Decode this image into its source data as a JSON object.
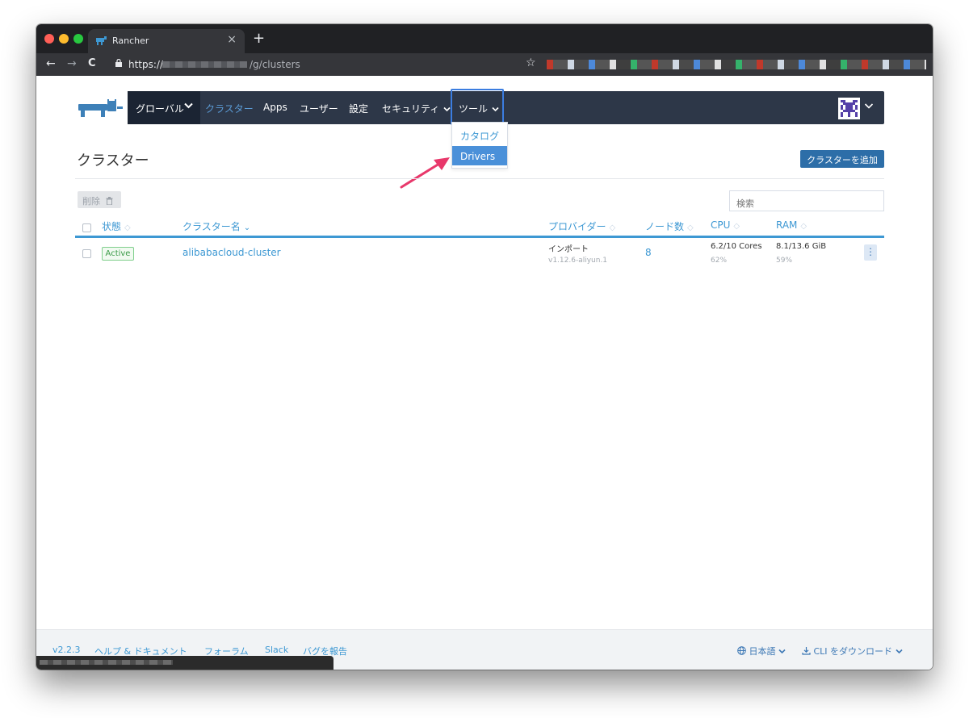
{
  "browser": {
    "tab_title": "Rancher",
    "tab_close": "×",
    "new_tab": "+",
    "back": "←",
    "forward": "→",
    "reload": "C",
    "url_scheme": "https://",
    "url_path": "/g/clusters",
    "star": "☆"
  },
  "nav": {
    "global_label": "グローバル",
    "items": [
      {
        "label": "クラスター",
        "active": true
      },
      {
        "label": "Apps"
      },
      {
        "label": "ユーザー"
      },
      {
        "label": "設定"
      },
      {
        "label": "セキュリティ"
      },
      {
        "label": "ツール"
      }
    ],
    "tools_menu": [
      "カタログ",
      "Drivers"
    ]
  },
  "page": {
    "title": "クラスター",
    "add_button": "クラスターを追加",
    "delete_button": "削除",
    "search_placeholder": "検索"
  },
  "table": {
    "headers": [
      "状態",
      "クラスター名",
      "プロバイダー",
      "ノード数",
      "CPU",
      "RAM"
    ],
    "sorted_column": "クラスター名",
    "rows": [
      {
        "state": "Active",
        "name": "alibabacloud-cluster",
        "provider": "インポート",
        "provider_version": "v1.12.6-aliyun.1",
        "nodes": "8",
        "cpu": "6.2/10 Cores",
        "cpu_pct": "62%",
        "ram": "8.1/13.6 GiB",
        "ram_pct": "59%",
        "actions": "⋮"
      }
    ]
  },
  "footer": {
    "version": "v2.2.3",
    "help": "ヘルプ & ドキュメント",
    "forum": "フォーラム",
    "slack": "Slack",
    "report_bug": "バグを報告",
    "language": "日本語",
    "cli": "CLI をダウンロード"
  },
  "colors": {
    "header_bg": "#2d3748",
    "accent": "#3d98d3",
    "primary_button": "#2d6ea8",
    "active_badge": "#3b9b48",
    "annotation_arrow": "#e8386b"
  },
  "icons": [
    "rancher-logo",
    "chevron-down-icon",
    "trash-icon",
    "sort-icon",
    "kebab-icon",
    "globe-icon",
    "download-icon",
    "lock-icon",
    "star-icon",
    "avatar"
  ]
}
